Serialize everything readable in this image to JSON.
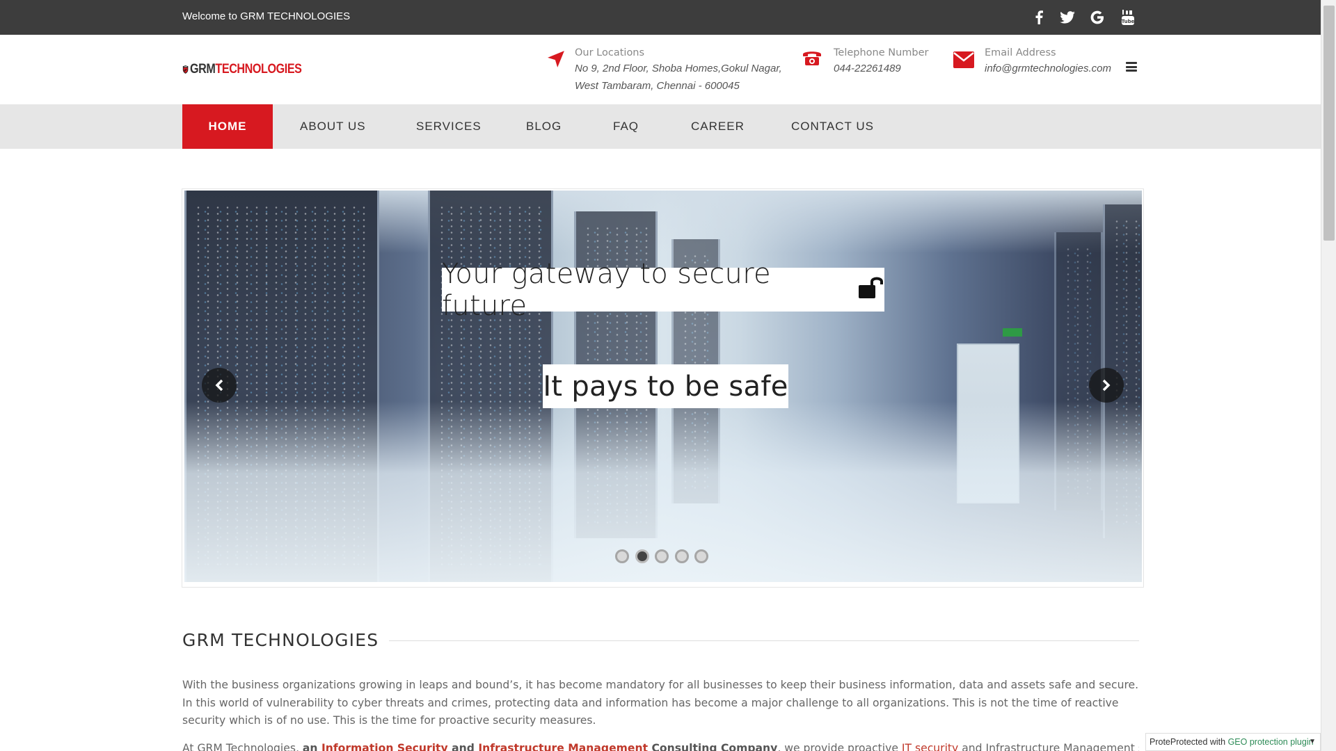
{
  "topbar": {
    "welcome": "Welcome to GRM TECHNOLOGIES",
    "social": [
      "facebook-icon",
      "twitter-icon",
      "google-icon",
      "youtube-icon"
    ]
  },
  "header": {
    "logo": {
      "badge": "GRM",
      "name_part1": "GRM",
      "name_part2": "TECHNOLOGIES"
    },
    "location": {
      "label": "Our Locations",
      "line1": "No 9, 2nd Floor, Shoba Homes,Gokul Nagar,",
      "line2": "West Tambaram, Chennai - 600045"
    },
    "phone": {
      "label": "Telephone Number",
      "value": "044-22261489"
    },
    "email": {
      "label": "Email Address",
      "value": "info@grmtechnologies.com"
    }
  },
  "nav": {
    "items": [
      "HOME",
      "ABOUT US",
      "SERVICES",
      "BLOG",
      "FAQ",
      "CAREER",
      "CONTACT US"
    ],
    "active_index": 0
  },
  "slider": {
    "caption1": "Your gateway to secure future",
    "caption2": "It pays to be safe",
    "slides_count": 5,
    "active_slide": 2
  },
  "content": {
    "title": "GRM TECHNOLOGIES",
    "paragraph1": "With the business organizations growing in leaps and bound’s, it has become mandatory for all businesses to keep their business information, data and assets safe and secure. In this world of vulnerability to cyber threats and crimes, protecting data and information has become a major challenge to all organizations. This is not the time of reactive security which is of no use. This is the time for proactive security measures.",
    "p2": {
      "t1": "At GRM Technologies, ",
      "t2": "an ",
      "t3": "Information Security",
      "t4": " and ",
      "t5": "Infrastructure Management",
      "t6": " Consulting Company",
      "t7": ", we provide proactive ",
      "t8": "IT security",
      "t9": " and Infrastructure Management services"
    }
  },
  "geo_badge": {
    "prefix": "Prote",
    "text": "Protected with ",
    "link": "GEO protection plugin"
  },
  "colors": {
    "brand_red": "#d71920",
    "topbar": "#3d3d3d",
    "nav_bg": "#e6e6e6"
  }
}
